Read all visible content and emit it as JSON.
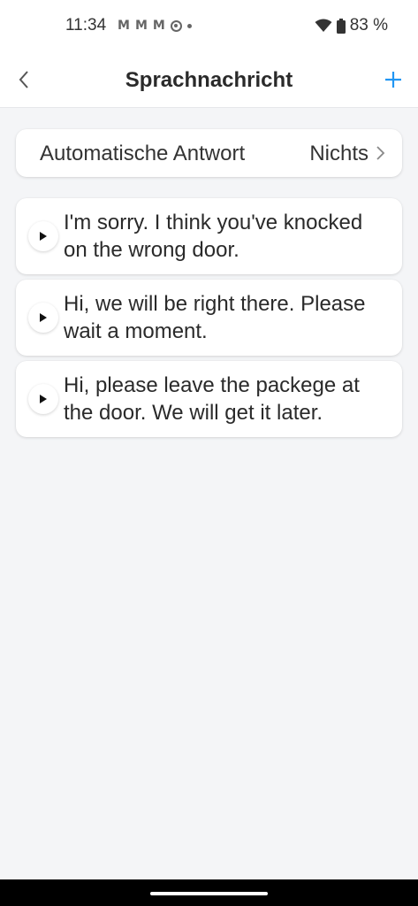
{
  "status": {
    "time": "11:34",
    "battery_text": "83 %",
    "icons": [
      "gmail-icon",
      "gmail-icon",
      "gmail-icon",
      "sync-icon",
      "dot-icon",
      "wifi-icon",
      "battery-icon"
    ]
  },
  "header": {
    "title": "Sprachnachricht",
    "back_icon": "chevron-left-icon",
    "add_icon": "plus-icon",
    "accent_color": "#2196f3"
  },
  "auto_reply": {
    "label": "Automatische Antwort",
    "value": "Nichts"
  },
  "messages": [
    {
      "text": "I'm sorry. I think you've knocked on the wrong door."
    },
    {
      "text": "Hi, we will be right there. Please wait a moment."
    },
    {
      "text": "Hi, please leave the packege at the door. We will get it later."
    }
  ]
}
